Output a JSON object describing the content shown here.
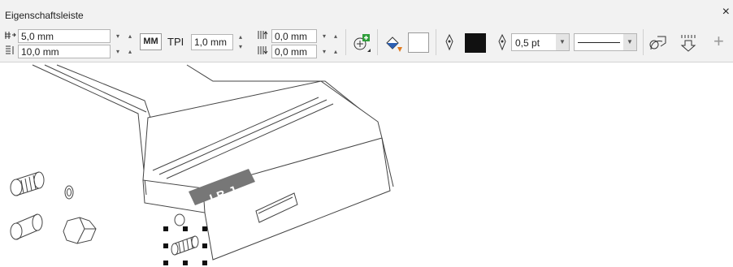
{
  "toolbar": {
    "title": "Eigenschaftsleiste",
    "close_glyph": "×",
    "field_width": "5,0 mm",
    "field_height": "10,0 mm",
    "unit_button": "MM",
    "tpi_label": "TPI",
    "tpi_value": "1,0 mm",
    "offset_top": "0,0 mm",
    "offset_bottom": "0,0 mm",
    "outline_width": "0,5 pt",
    "fill_swatch_color": "#ffffff",
    "outline_swatch_color": "#111111",
    "icons": [
      "width-icon",
      "height-icon",
      "offset-top-icon",
      "offset-bottom-icon",
      "add-object-icon",
      "fill-bucket-icon",
      "pen-nib-icon",
      "pen-nib-small-icon",
      "convert-outline-icon",
      "threading-icon",
      "plus-icon"
    ]
  },
  "drawing": {
    "logo_text": "IBJ"
  }
}
